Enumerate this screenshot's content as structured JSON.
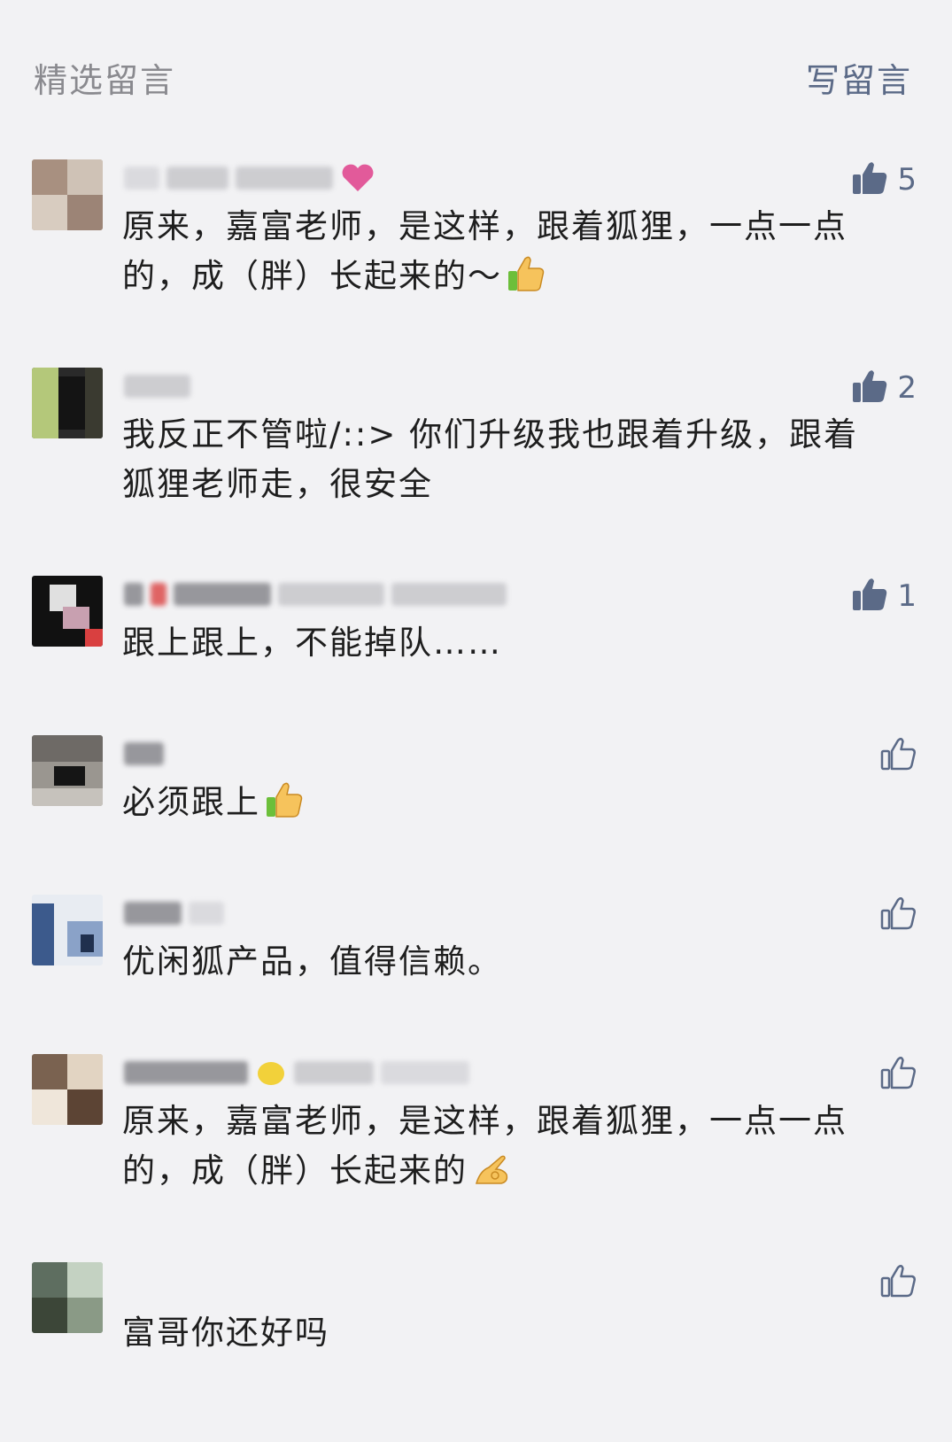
{
  "header": {
    "title": "精选留言",
    "write_label": "写留言"
  },
  "colors": {
    "background": "#f2f2f4",
    "like_blue": "#5b6a87",
    "muted_gray": "#8a8a8f"
  },
  "comments": [
    {
      "content": "原来，嘉富老师，是这样，跟着狐狸，一点一点的，成（胖）长起来的～",
      "likes": "5",
      "liked": true,
      "emoji": "thumbs-up"
    },
    {
      "content": "我反正不管啦/::> 你们升级我也跟着升级，跟着狐狸老师走，很安全",
      "likes": "2",
      "liked": true,
      "emoji": ""
    },
    {
      "content": "跟上跟上，不能掉队……",
      "likes": "1",
      "liked": true,
      "emoji": ""
    },
    {
      "content": "必须跟上",
      "likes": "",
      "liked": false,
      "emoji": "thumbs-up"
    },
    {
      "content": "优闲狐产品，值得信赖。",
      "likes": "",
      "liked": false,
      "emoji": ""
    },
    {
      "content": "原来，嘉富老师，是这样，跟着狐狸，一点一点的，成（胖）长起来的",
      "likes": "",
      "liked": false,
      "emoji": "ok-hand"
    },
    {
      "content": "富哥你还好吗",
      "likes": "",
      "liked": false,
      "emoji": ""
    }
  ]
}
